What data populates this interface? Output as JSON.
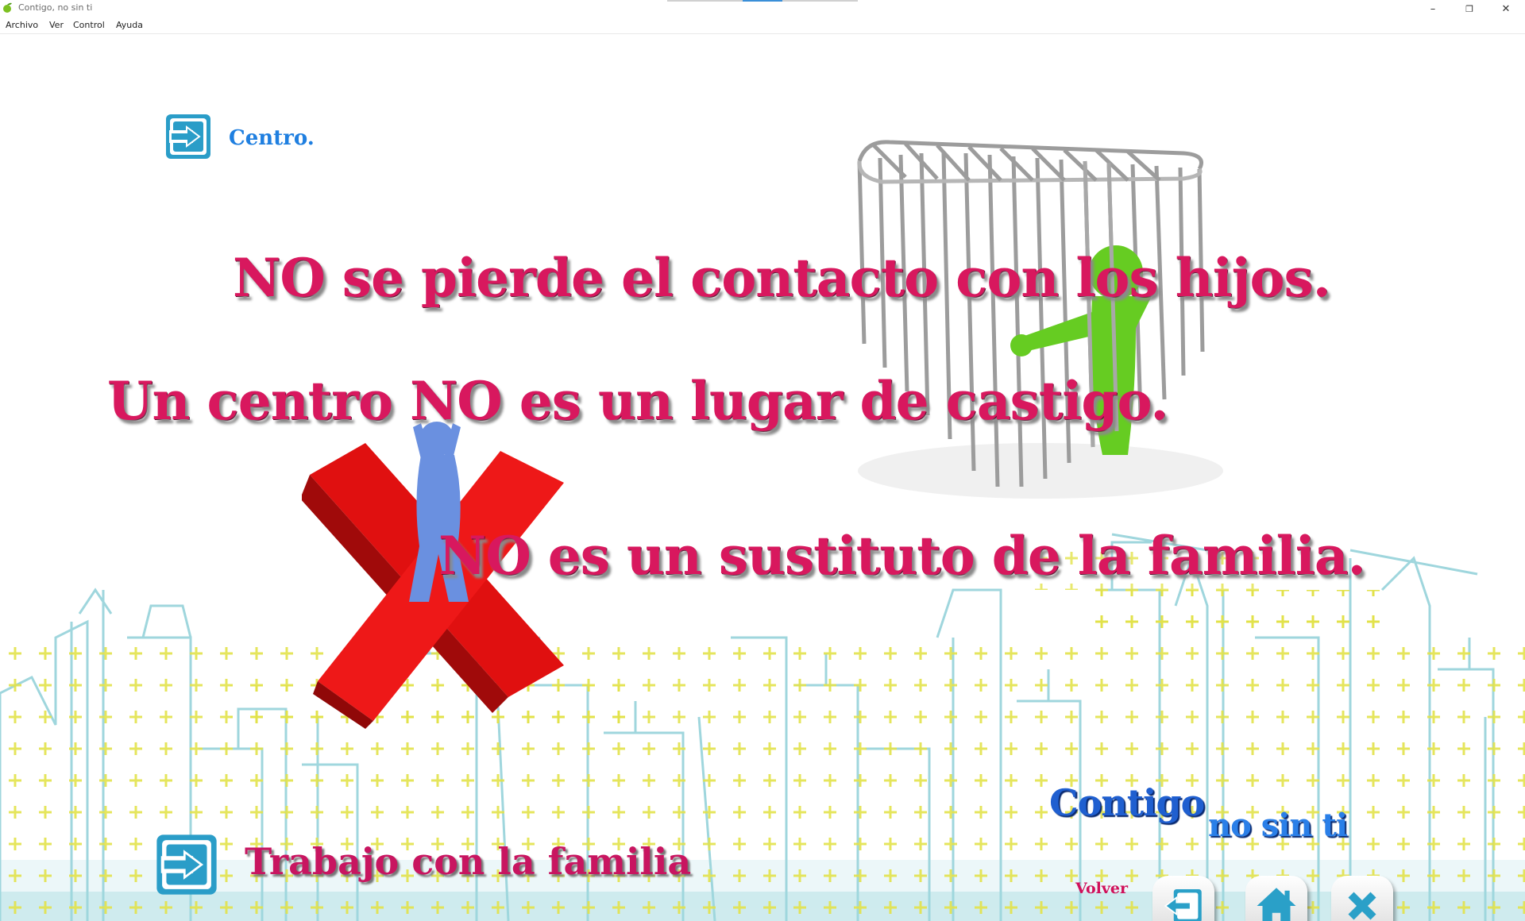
{
  "window": {
    "title": "Contigo, no sin ti",
    "controls": {
      "minimize": "–",
      "maximize": "❐",
      "close": "✕"
    }
  },
  "menu": [
    "Archivo",
    "Ver",
    "Control",
    "Ayuda"
  ],
  "main": {
    "centro_link": "Centro.",
    "headlines": [
      "NO se pierde el contacto con los hijos.",
      "Un centro NO es un lugar de castigo.",
      "NO es un sustituto de la familia."
    ],
    "familia_link": "Trabajo con la familia"
  },
  "branding": {
    "line1": "Contigo",
    "line2": "no sin ti"
  },
  "footer": {
    "volver_label": "Volver"
  },
  "icons": {
    "centro": "enter-icon",
    "familia": "enter-icon",
    "volver": "exit-icon",
    "home": "home-icon",
    "close": "close-icon"
  },
  "colors": {
    "headline": "#d8185e",
    "link_blue": "#1f7fe0",
    "button_teal": "#2aa0c8",
    "cross_red": "#e01010"
  }
}
